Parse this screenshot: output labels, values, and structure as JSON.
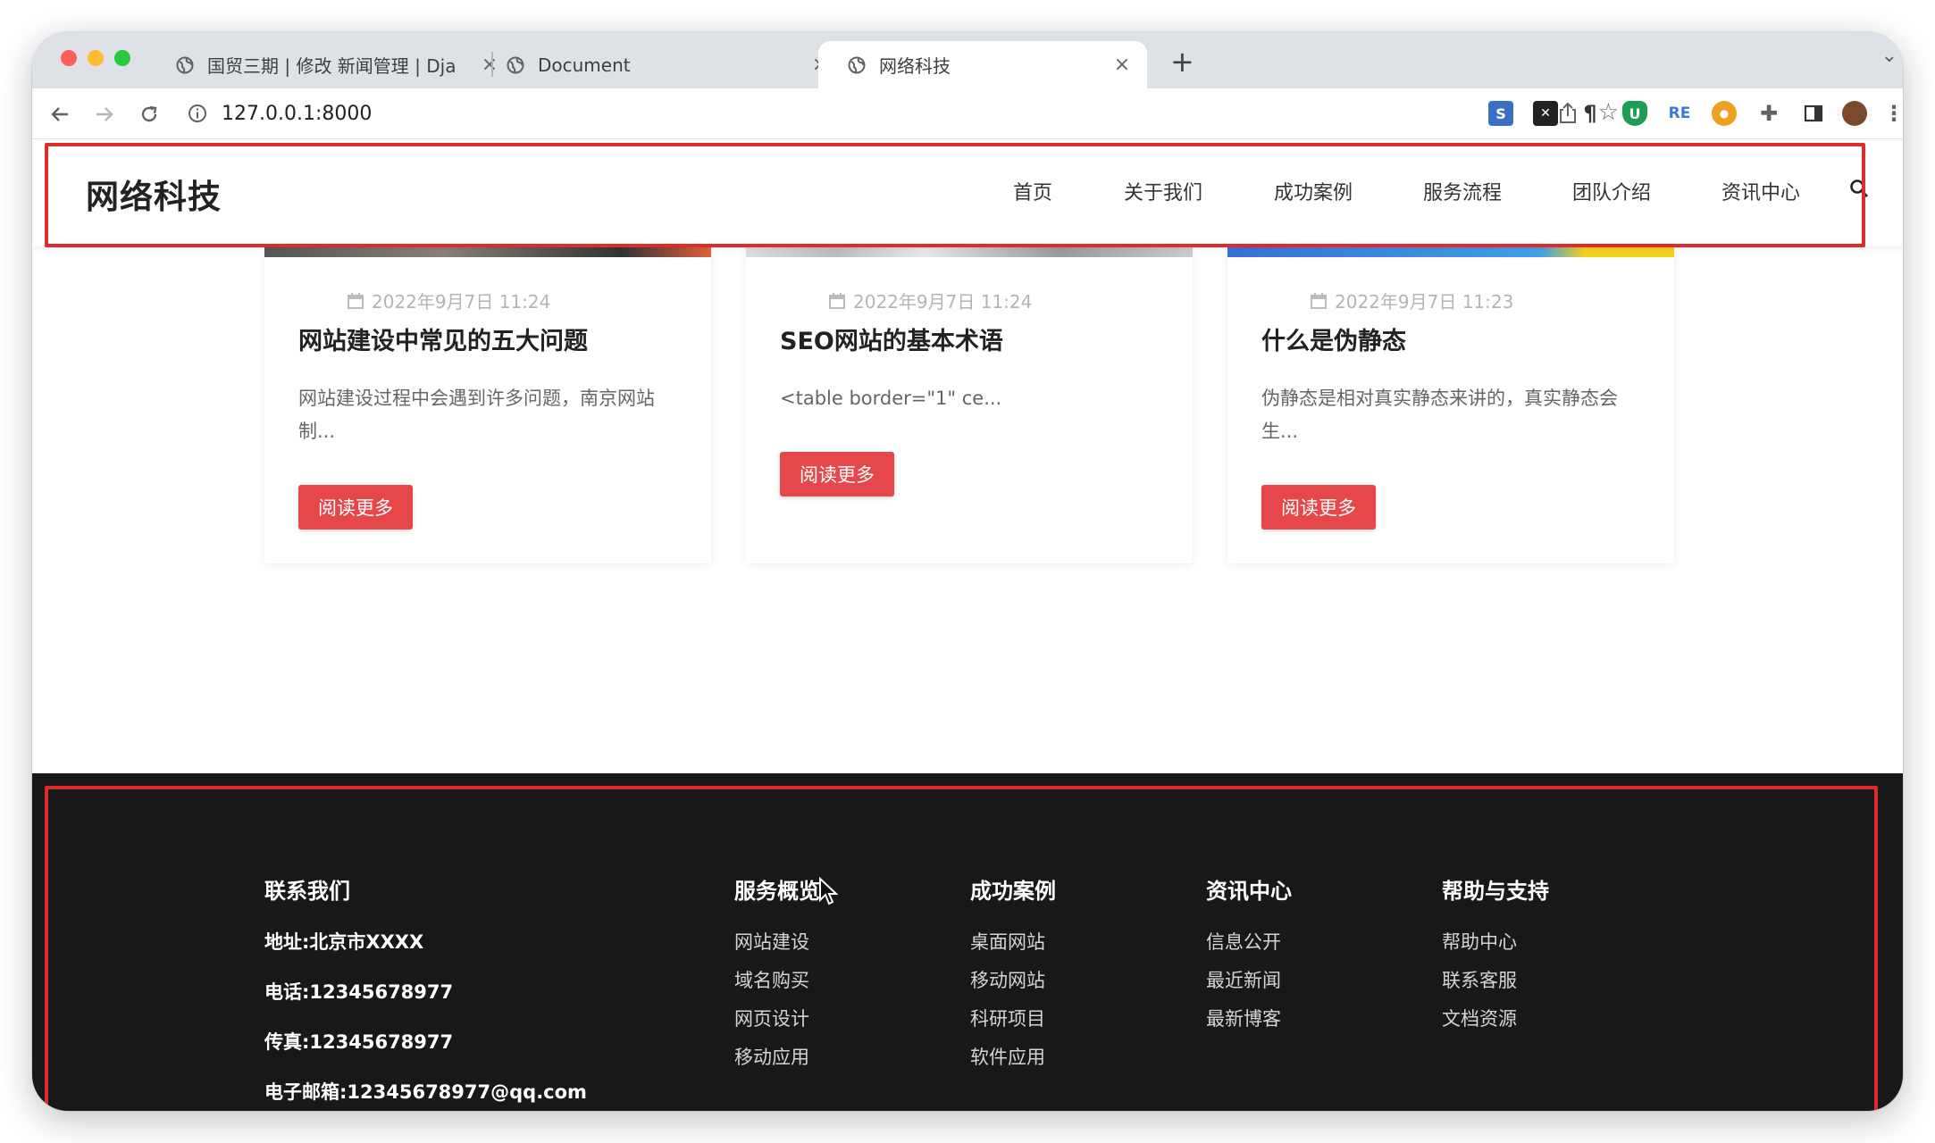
{
  "browser": {
    "tabs": [
      {
        "title": "国贸三期 | 修改 新闻管理 | Djang",
        "active": false
      },
      {
        "title": "Document",
        "active": false
      },
      {
        "title": "网络科技",
        "active": true
      }
    ],
    "new_tab_label": "+",
    "url": "127.0.0.1:8000",
    "extensions": [
      "screen-capture-icon",
      "x-extension-icon",
      "paragraph-extension-icon",
      "shield-extension-icon",
      "re-extension-icon",
      "orange-extension-icon",
      "puzzle-icon",
      "sidepanel-icon",
      "profile-avatar"
    ]
  },
  "site": {
    "logo": "网络科技",
    "nav": [
      "首页",
      "关于我们",
      "成功案例",
      "服务流程",
      "团队介绍",
      "资讯中心"
    ]
  },
  "cards": [
    {
      "date": "2022年9月7日 11:24",
      "title": "网站建设中常见的五大问题",
      "excerpt": "网站建设过程中会遇到许多问题，南京网站制...",
      "button": "阅读更多"
    },
    {
      "date": "2022年9月7日 11:24",
      "title": "SEO网站的基本术语",
      "excerpt": "<table border=\"1\" ce...",
      "button": "阅读更多"
    },
    {
      "date": "2022年9月7日 11:23",
      "title": "什么是伪静态",
      "excerpt": "伪静态是相对真实静态来讲的，真实静态会生...",
      "button": "阅读更多"
    }
  ],
  "footer": {
    "contact": {
      "heading": "联系我们",
      "lines": [
        "地址:北京市XXXX",
        "电话:12345678977",
        "传真:12345678977",
        "电子邮箱:12345678977@qq.com"
      ]
    },
    "columns": [
      {
        "heading": "服务概览",
        "links": [
          "网站建设",
          "域名购买",
          "网页设计",
          "移动应用"
        ]
      },
      {
        "heading": "成功案例",
        "links": [
          "桌面网站",
          "移动网站",
          "科研项目",
          "软件应用"
        ]
      },
      {
        "heading": "资讯中心",
        "links": [
          "信息公开",
          "最近新闻",
          "最新博客"
        ]
      },
      {
        "heading": "帮助与支持",
        "links": [
          "帮助中心",
          "联系客服",
          "文档资源"
        ]
      }
    ]
  },
  "colors": {
    "accent": "#e6474a",
    "highlight_box": "#e02b2b",
    "footer_bg": "#181818"
  }
}
